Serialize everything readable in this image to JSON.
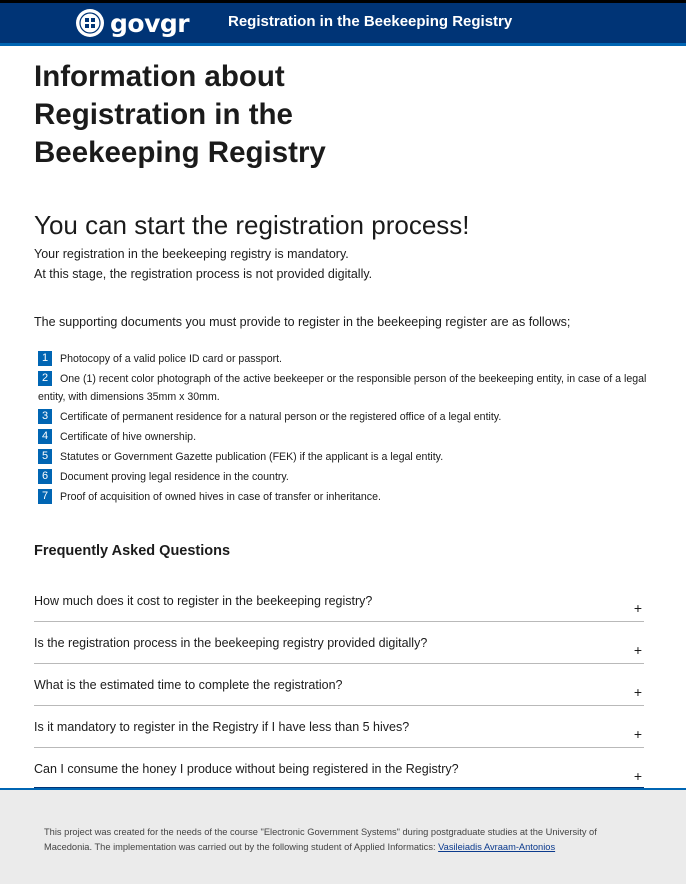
{
  "header": {
    "logo_text_gov": "gov",
    "logo_text_gr": "gr",
    "title": "Registration in the Beekeeping Registry"
  },
  "page": {
    "title": "Information about Registration in the Beekeeping Registry"
  },
  "intro": {
    "heading": "You can start the registration process!",
    "line1": "Your registration in the beekeeping registry is mandatory.",
    "line2": "At this stage, the registration process is not provided digitally."
  },
  "documents": {
    "intro": "The supporting documents you must provide to register in the beekeeping register are as follows;",
    "items": [
      {
        "num": "1",
        "text": "Photocopy of a valid police ID card or passport."
      },
      {
        "num": "2",
        "text": "One (1) recent color photograph of the active beekeeper or the responsible person of the beekeeping entity, in case of a legal entity, with dimensions 35mm x 30mm."
      },
      {
        "num": "3",
        "text": "Certificate of permanent residence for a natural person or the registered office of a legal entity."
      },
      {
        "num": "4",
        "text": "Certificate of hive ownership."
      },
      {
        "num": "5",
        "text": "Statutes or Government Gazette publication (FEK) if the applicant is a legal entity."
      },
      {
        "num": "6",
        "text": "Document proving legal residence in the country."
      },
      {
        "num": "7",
        "text": "Proof of acquisition of owned hives in case of transfer or inheritance."
      }
    ]
  },
  "faq": {
    "title": "Frequently Asked Questions",
    "expand_symbol": "+",
    "items": [
      {
        "question": "How much does it cost to register in the beekeeping registry?"
      },
      {
        "question": "Is the registration process in the beekeeping registry provided digitally?"
      },
      {
        "question": "What is the estimated time to complete the registration?"
      },
      {
        "question": "Is it mandatory to register in the Registry if I have less than 5 hives?"
      },
      {
        "question": "Can I consume the honey I produce without being registered in the Registry?"
      }
    ]
  },
  "footer": {
    "text": "This project was created for the needs of the course \"Electronic Government Systems\" during postgraduate studies at the University of Macedonia. The implementation was carried out by the following student of Applied Informatics: ",
    "author_link": "Vasileiadis Avraam-Antonios"
  },
  "colors": {
    "header_bg": "#003476",
    "accent": "#0065b3",
    "footer_bg": "#ebebeb"
  }
}
